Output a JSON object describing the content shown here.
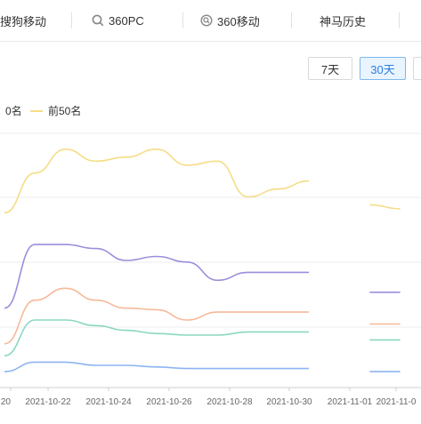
{
  "tabs": [
    {
      "label": "搜狗移动",
      "icon": "none"
    },
    {
      "label": "360PC",
      "icon": "search-icon"
    },
    {
      "label": "360移动",
      "icon": "mobile-search-icon"
    },
    {
      "label": "神马历史",
      "icon": "none"
    }
  ],
  "range_buttons": [
    {
      "label": "7天",
      "active": false
    },
    {
      "label": "30天",
      "active": true
    },
    {
      "label": "",
      "active": false
    }
  ],
  "legend": [
    {
      "label": "0名",
      "color": "#9a8fdb"
    },
    {
      "label": "前50名",
      "color": "#f5dd86"
    }
  ],
  "chart_data": {
    "type": "line",
    "x": [
      "10-20",
      "10-21",
      "10-22",
      "10-23",
      "10-24",
      "10-25",
      "10-26",
      "10-27",
      "10-28",
      "10-29",
      "10-30",
      "10-31",
      "11-01",
      "11-02"
    ],
    "tick_labels": [
      "20",
      "2021-10-22",
      "2021-10-24",
      "2021-10-26",
      "2021-10-28",
      "2021-10-30",
      "2021-11-01",
      "2021-11-0"
    ],
    "grid": true,
    "legend_position": "top-left",
    "series": [
      {
        "name": "前50名",
        "color": "#f5dd86",
        "values": [
          260,
          310,
          340,
          325,
          330,
          340,
          320,
          325,
          280,
          290,
          300,
          null,
          270,
          265
        ]
      },
      {
        "name": "",
        "color": "#9a8fdb",
        "values": [
          140,
          220,
          220,
          215,
          200,
          205,
          198,
          175,
          185,
          185,
          185,
          null,
          160,
          160
        ]
      },
      {
        "name": "",
        "color": "#f7b999",
        "values": [
          95,
          150,
          165,
          150,
          140,
          138,
          125,
          135,
          135,
          135,
          135,
          null,
          120,
          120
        ]
      },
      {
        "name": "",
        "color": "#8ad8c0",
        "values": [
          80,
          125,
          125,
          118,
          112,
          108,
          106,
          106,
          110,
          110,
          110,
          null,
          100,
          100
        ]
      },
      {
        "name": "",
        "color": "#8db4f0",
        "values": [
          60,
          72,
          72,
          68,
          68,
          66,
          64,
          64,
          64,
          64,
          64,
          null,
          60,
          60
        ]
      }
    ],
    "ylim": [
      40,
      360
    ]
  }
}
